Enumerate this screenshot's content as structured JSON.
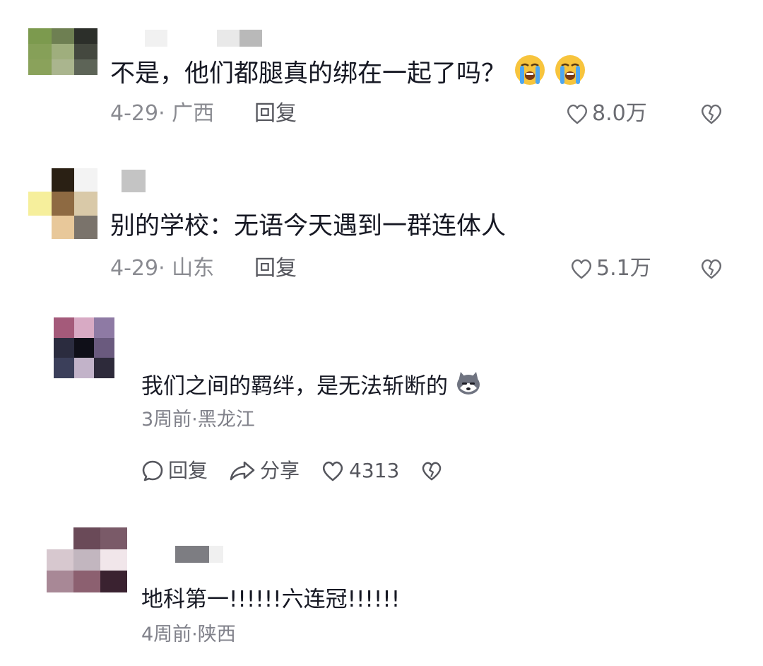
{
  "comments": [
    {
      "text": "不是，他们都腿真的绑在一起了吗？",
      "date": "4-29",
      "location": "广西",
      "reply_label": "回复",
      "likes": "8.0万",
      "emoji": "loudly-crying-face"
    },
    {
      "text": "别的学校：无语今天遇到一群连体人",
      "date": "4-29",
      "location": "山东",
      "reply_label": "回复",
      "likes": "5.1万"
    }
  ],
  "subcomment": {
    "text": "我们之间的羁绊，是无法斩断的",
    "time_location": "3周前·黑龙江",
    "reply_label": "回复",
    "share_label": "分享",
    "likes": "4313",
    "emoji": "husky-dog-face"
  },
  "subcomment2": {
    "text": "地科第一!!!!!!六连冠!!!!!!",
    "time_location": "4周前·陕西"
  },
  "colors": {
    "text": "#161823",
    "meta": "#8a8b91",
    "icon": "#6b6c72"
  }
}
